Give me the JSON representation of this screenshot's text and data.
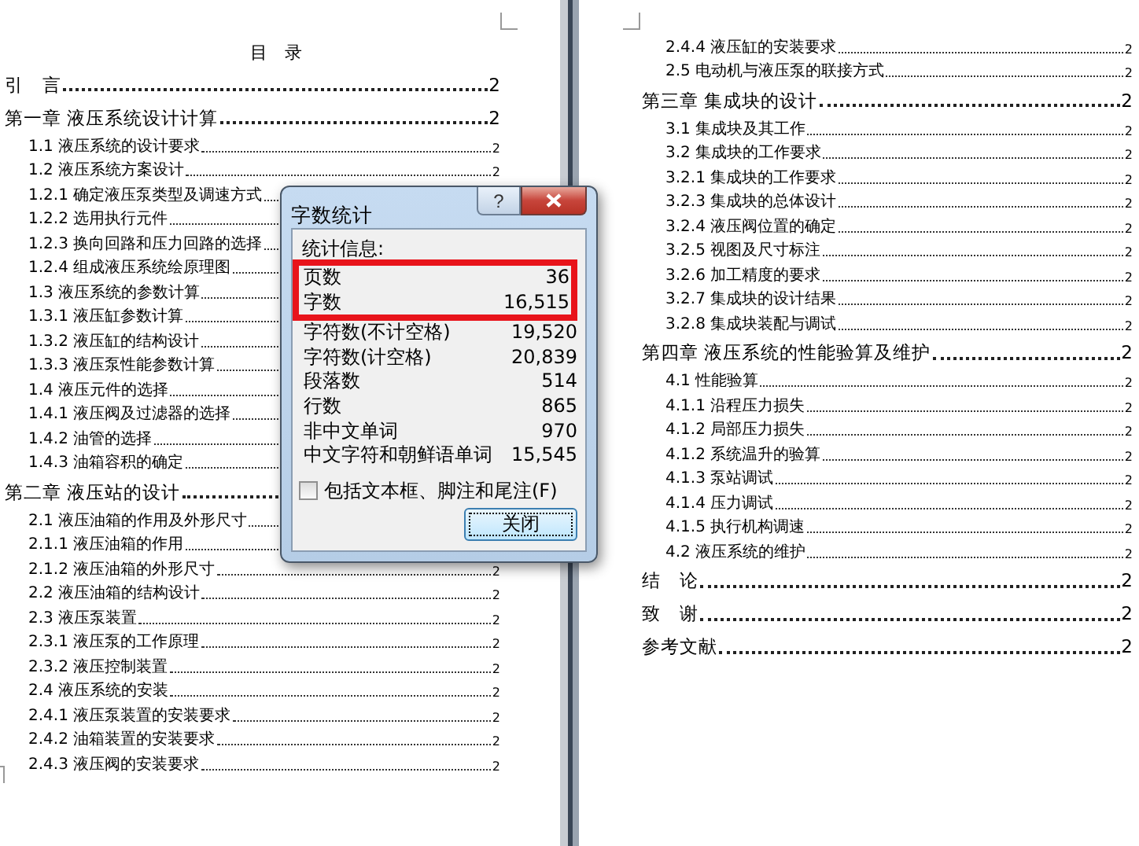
{
  "document": {
    "pages": [
      {
        "title": "目　录",
        "entries": [
          {
            "kind": "chapter",
            "text": "引　言",
            "page": "2"
          },
          {
            "kind": "chapter",
            "text": "第一章 液压系统设计计算",
            "page": "2"
          },
          {
            "kind": "section",
            "text": "1.1 液压系统的设计要求",
            "page": "2"
          },
          {
            "kind": "section",
            "text": "1.2 液压系统方案设计",
            "page": "2"
          },
          {
            "kind": "section",
            "text": "1.2.1 确定液压泵类型及调速方式"
          },
          {
            "kind": "section",
            "text": "1.2.2 选用执行元件"
          },
          {
            "kind": "section",
            "text": "1.2.3 换向回路和压力回路的选择"
          },
          {
            "kind": "section",
            "text": "1.2.4 组成液压系统绘原理图"
          },
          {
            "kind": "section",
            "text": "1.3 液压系统的参数计算"
          },
          {
            "kind": "section",
            "text": "1.3.1 液压缸参数计算"
          },
          {
            "kind": "section",
            "text": "1.3.2 液压缸的结构设计"
          },
          {
            "kind": "section",
            "text": "1.3.3 液压泵性能参数计算"
          },
          {
            "kind": "section",
            "text": "1.4 液压元件的选择"
          },
          {
            "kind": "section",
            "text": "1.4.1 液压阀及过滤器的选择"
          },
          {
            "kind": "section",
            "text": "1.4.2 油管的选择"
          },
          {
            "kind": "section",
            "text": "1.4.3 油箱容积的确定"
          },
          {
            "kind": "chapter",
            "text": "第二章 液压站的设计"
          },
          {
            "kind": "section",
            "text": "2.1 液压油箱的作用及外形尺寸"
          },
          {
            "kind": "section",
            "text": "2.1.1 液压油箱的作用"
          },
          {
            "kind": "section",
            "text": "2.1.2 液压油箱的外形尺寸",
            "page": "2"
          },
          {
            "kind": "section",
            "text": "2.2 液压油箱的结构设计",
            "page": "2"
          },
          {
            "kind": "section",
            "text": "2.3 液压泵装置",
            "page": "2"
          },
          {
            "kind": "section",
            "text": "2.3.1 液压泵的工作原理",
            "page": "2"
          },
          {
            "kind": "section",
            "text": "2.3.2 液压控制装置",
            "page": "2"
          },
          {
            "kind": "section",
            "text": "2.4 液压系统的安装",
            "page": "2"
          },
          {
            "kind": "section",
            "text": "2.4.1 液压泵装置的安装要求",
            "page": "2"
          },
          {
            "kind": "section",
            "text": "2.4.2 油箱装置的安装要求",
            "page": "2"
          },
          {
            "kind": "section",
            "text": "2.4.3 液压阀的安装要求",
            "page": "2"
          }
        ]
      },
      {
        "entries": [
          {
            "kind": "section",
            "text": "2.4.4 液压缸的安装要求",
            "page": "2"
          },
          {
            "kind": "section",
            "text": "2.5 电动机与液压泵的联接方式",
            "page": "2"
          },
          {
            "kind": "chapter",
            "text": "第三章 集成块的设计",
            "page": "2"
          },
          {
            "kind": "section",
            "text": "3.1 集成块及其工作",
            "page": "2"
          },
          {
            "kind": "section",
            "text": "3.2 集成块的工作要求",
            "page": "2"
          },
          {
            "kind": "section",
            "text": "3.2.1 集成块的工作要求",
            "page": "2"
          },
          {
            "kind": "section",
            "text": "3.2.3 集成块的总体设计",
            "page": "2"
          },
          {
            "kind": "section",
            "text": "3.2.4 液压阀位置的确定",
            "page": "2"
          },
          {
            "kind": "section",
            "text": "3.2.5 视图及尺寸标注",
            "page": "2"
          },
          {
            "kind": "section",
            "text": "3.2.6 加工精度的要求",
            "page": "2"
          },
          {
            "kind": "section",
            "text": "3.2.7 集成块的设计结果",
            "page": "2"
          },
          {
            "kind": "section",
            "text": "3.2.8 集成块装配与调试",
            "page": "2"
          },
          {
            "kind": "chapter",
            "text": "第四章 液压系统的性能验算及维护",
            "page": "2"
          },
          {
            "kind": "section",
            "text": "4.1 性能验算",
            "page": "2"
          },
          {
            "kind": "section",
            "text": "4.1.1 沿程压力损失",
            "page": "2"
          },
          {
            "kind": "section",
            "text": "4.1.2 局部压力损失",
            "page": "2"
          },
          {
            "kind": "section",
            "text": "4.1.2 系统温升的验算",
            "page": "2"
          },
          {
            "kind": "section",
            "text": "4.1.3 泵站调试",
            "page": "2"
          },
          {
            "kind": "section",
            "text": "4.1.4 压力调试",
            "page": "2"
          },
          {
            "kind": "section",
            "text": "4.1.5 执行机构调速",
            "page": "2"
          },
          {
            "kind": "section",
            "text": "4.2 液压系统的维护",
            "page": "2"
          },
          {
            "kind": "chapter",
            "text": "结　论",
            "page": "2"
          },
          {
            "kind": "chapter",
            "text": "致　谢",
            "page": "2"
          },
          {
            "kind": "chapter",
            "text": "参考文献",
            "page": "2"
          }
        ]
      }
    ]
  },
  "dialog": {
    "title": "字数统计",
    "help_glyph": "?",
    "group_label": "统计信息:",
    "stats": [
      {
        "label": "页数",
        "value": "36",
        "highlighted": true
      },
      {
        "label": "字数",
        "value": "16,515",
        "highlighted": true
      },
      {
        "label": "字符数(不计空格)",
        "value": "19,520",
        "highlighted": false
      },
      {
        "label": "字符数(计空格)",
        "value": "20,839",
        "highlighted": false
      },
      {
        "label": "段落数",
        "value": "514",
        "highlighted": false
      },
      {
        "label": "行数",
        "value": "865",
        "highlighted": false
      },
      {
        "label": "非中文单词",
        "value": "970",
        "highlighted": false
      },
      {
        "label": "中文字符和朝鲜语单词",
        "value": "15,545",
        "highlighted": false
      }
    ],
    "include_option": {
      "label": "包括文本框、脚注和尾注(F)",
      "checked": false
    },
    "buttons": [
      "关闭"
    ]
  }
}
